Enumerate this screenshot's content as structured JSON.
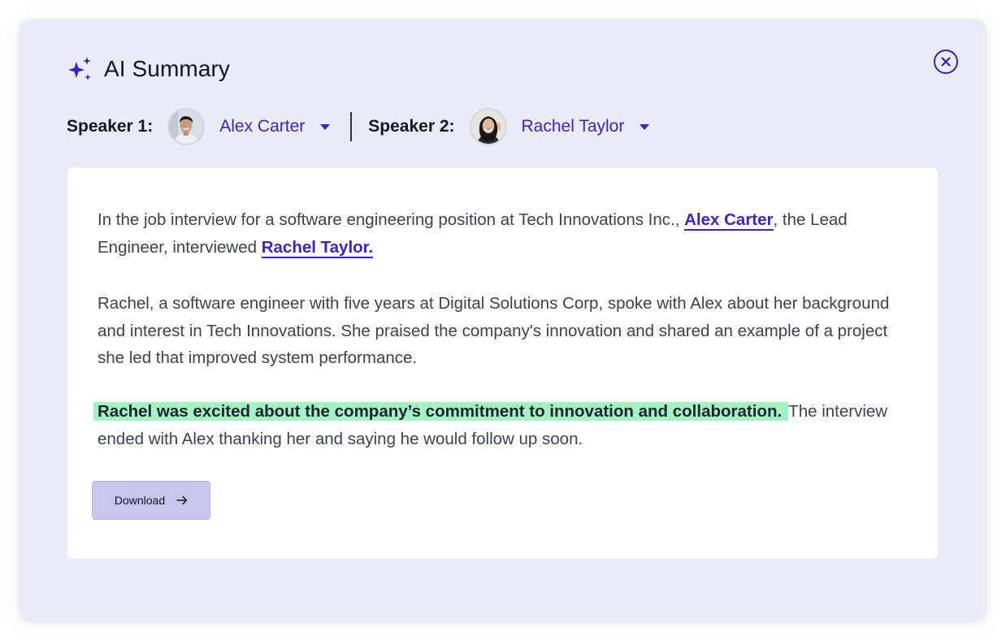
{
  "header": {
    "title": "AI Summary",
    "icon": "sparkle-icon"
  },
  "close": {
    "icon": "close-icon"
  },
  "speakers": {
    "speaker1": {
      "label": "Speaker 1:",
      "name": "Alex Carter"
    },
    "speaker2": {
      "label": "Speaker 2:",
      "name": "Rachel Taylor"
    }
  },
  "summary": {
    "p1_before": "In the job interview for a software engineering position at Tech Innovations Inc., ",
    "p1_link1": "Alex Carter",
    "p1_middle": ", the Lead Engineer, interviewed ",
    "p1_link2": "Rachel Taylor.",
    "p2": "Rachel, a software engineer with five years at Digital Solutions Corp, spoke with Alex about her background and interest in Tech Innovations. She praised the company's innovation and shared an example of a project she led that improved system performance.",
    "p3_highlight": "Rachel was excited about the company’s commitment to innovation and collaboration.",
    "p3_rest": "The interview ended with Alex thanking her and saying he would follow up soon."
  },
  "download": {
    "label": "Download",
    "icon": "arrow-right-icon"
  },
  "colors": {
    "accent": "#3a24c4",
    "panel_bg": "#e9ecf6",
    "highlight": "#a3f2c4",
    "button_bg": "#c7c6ef"
  }
}
